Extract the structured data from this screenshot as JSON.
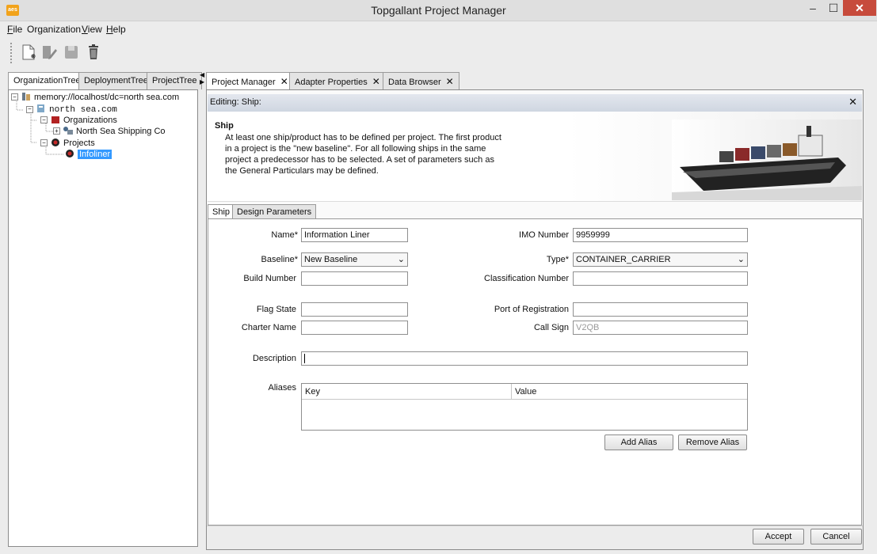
{
  "window": {
    "title": "Topgallant Project Manager",
    "app_icon_text": "aes"
  },
  "menu": [
    {
      "mnemonic": "F",
      "rest": "ile"
    },
    {
      "mnemonic": "",
      "rest": "Organization"
    },
    {
      "mnemonic": "V",
      "rest": "iew"
    },
    {
      "mnemonic": "H",
      "rest": "elp"
    }
  ],
  "toolbar": {
    "icons": [
      "new-document-icon",
      "edit-icon",
      "save-icon",
      "delete-icon"
    ]
  },
  "left_tabs": [
    "OrganizationTree",
    "DeploymentTree",
    "ProjectTree"
  ],
  "tree": {
    "root": "memory://localhost/dc=north sea.com",
    "domain": "north sea.com",
    "organizations": "Organizations",
    "org_item": "North Sea Shipping Co",
    "projects": "Projects",
    "project_item": "Infoliner"
  },
  "right_tabs": [
    {
      "label": "Project Manager"
    },
    {
      "label": "Adapter Properties"
    },
    {
      "label": "Data Browser"
    }
  ],
  "editor": {
    "header": "Editing: Ship:",
    "banner_title": "Ship",
    "banner_text": "At least one ship/product has to be defined per project. The first product in a project is the \"new baseline\". For all following ships in the same project a predecessor has to be selected. A set of parameters such as the General Particulars may be defined.",
    "tabs": [
      "Ship",
      "Design Parameters"
    ]
  },
  "form": {
    "name_label": "Name*",
    "name_value": "Information Liner",
    "imo_label": "IMO Number",
    "imo_value": "9959999",
    "baseline_label": "Baseline*",
    "baseline_value": "New Baseline",
    "type_label": "Type*",
    "type_value": "CONTAINER_CARRIER",
    "build_label": "Build Number",
    "build_value": "",
    "class_label": "Classification Number",
    "class_value": "",
    "flag_label": "Flag State",
    "flag_value": "",
    "port_label": "Port of Registration",
    "port_value": "",
    "charter_label": "Charter Name",
    "charter_value": "",
    "callsign_label": "Call Sign",
    "callsign_value": "V2QB",
    "description_label": "Description",
    "description_value": "",
    "aliases_label": "Aliases",
    "alias_columns": [
      "Key",
      "Value"
    ],
    "add_alias": "Add Alias",
    "remove_alias": "Remove Alias"
  },
  "footer": {
    "accept": "Accept",
    "cancel": "Cancel"
  },
  "colors": {
    "selection": "#3399ff",
    "close_button": "#c74b3c",
    "header_gradient": "#d6dce6"
  }
}
